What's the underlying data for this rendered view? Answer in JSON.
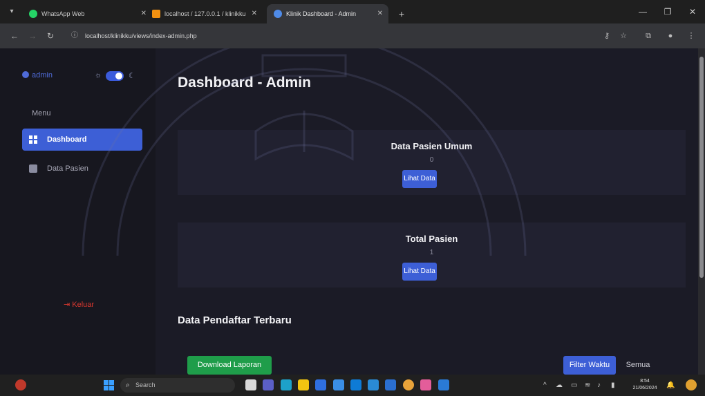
{
  "browser": {
    "tabs": [
      {
        "title": "WhatsApp Web",
        "favicon": "whatsapp-icon",
        "active": false
      },
      {
        "title": "localhost / 127.0.0.1 / klinikku",
        "favicon": "phpmyadmin-icon",
        "active": false
      },
      {
        "title": "Klinik Dashboard - Admin",
        "favicon": "user-icon",
        "active": true
      }
    ],
    "new_tab": "+",
    "url": "localhost/klinikku/views/index-admin.php"
  },
  "sidebar": {
    "user_name": "admin",
    "menu_label": "Menu",
    "items": [
      {
        "label": "Dashboard",
        "icon": "grid-icon",
        "active": true
      },
      {
        "label": "Data Pasien",
        "icon": "briefcase-icon",
        "active": false
      }
    ],
    "logout_label": "Keluar"
  },
  "main": {
    "title": "Dashboard - Admin",
    "cards": [
      {
        "title": "Data Pasien Umum",
        "value": "0",
        "button": "Lihat Data"
      },
      {
        "title": "Total Pasien",
        "value": "1",
        "button": "Lihat Data"
      }
    ],
    "section_title": "Data Pendaftar Terbaru",
    "download_button": "Download Laporan",
    "filter_button": "Filter Waktu",
    "all_button": "Semua"
  },
  "taskbar": {
    "search_placeholder": "Search",
    "time": "8:54",
    "date": "21/06/2024"
  },
  "colors": {
    "accent": "#3d5fd6",
    "success": "#1f9d4a",
    "danger": "#d9382f",
    "sidebar_bg": "#17171f",
    "main_bg": "#1b1b26",
    "card_bg": "#212130"
  }
}
